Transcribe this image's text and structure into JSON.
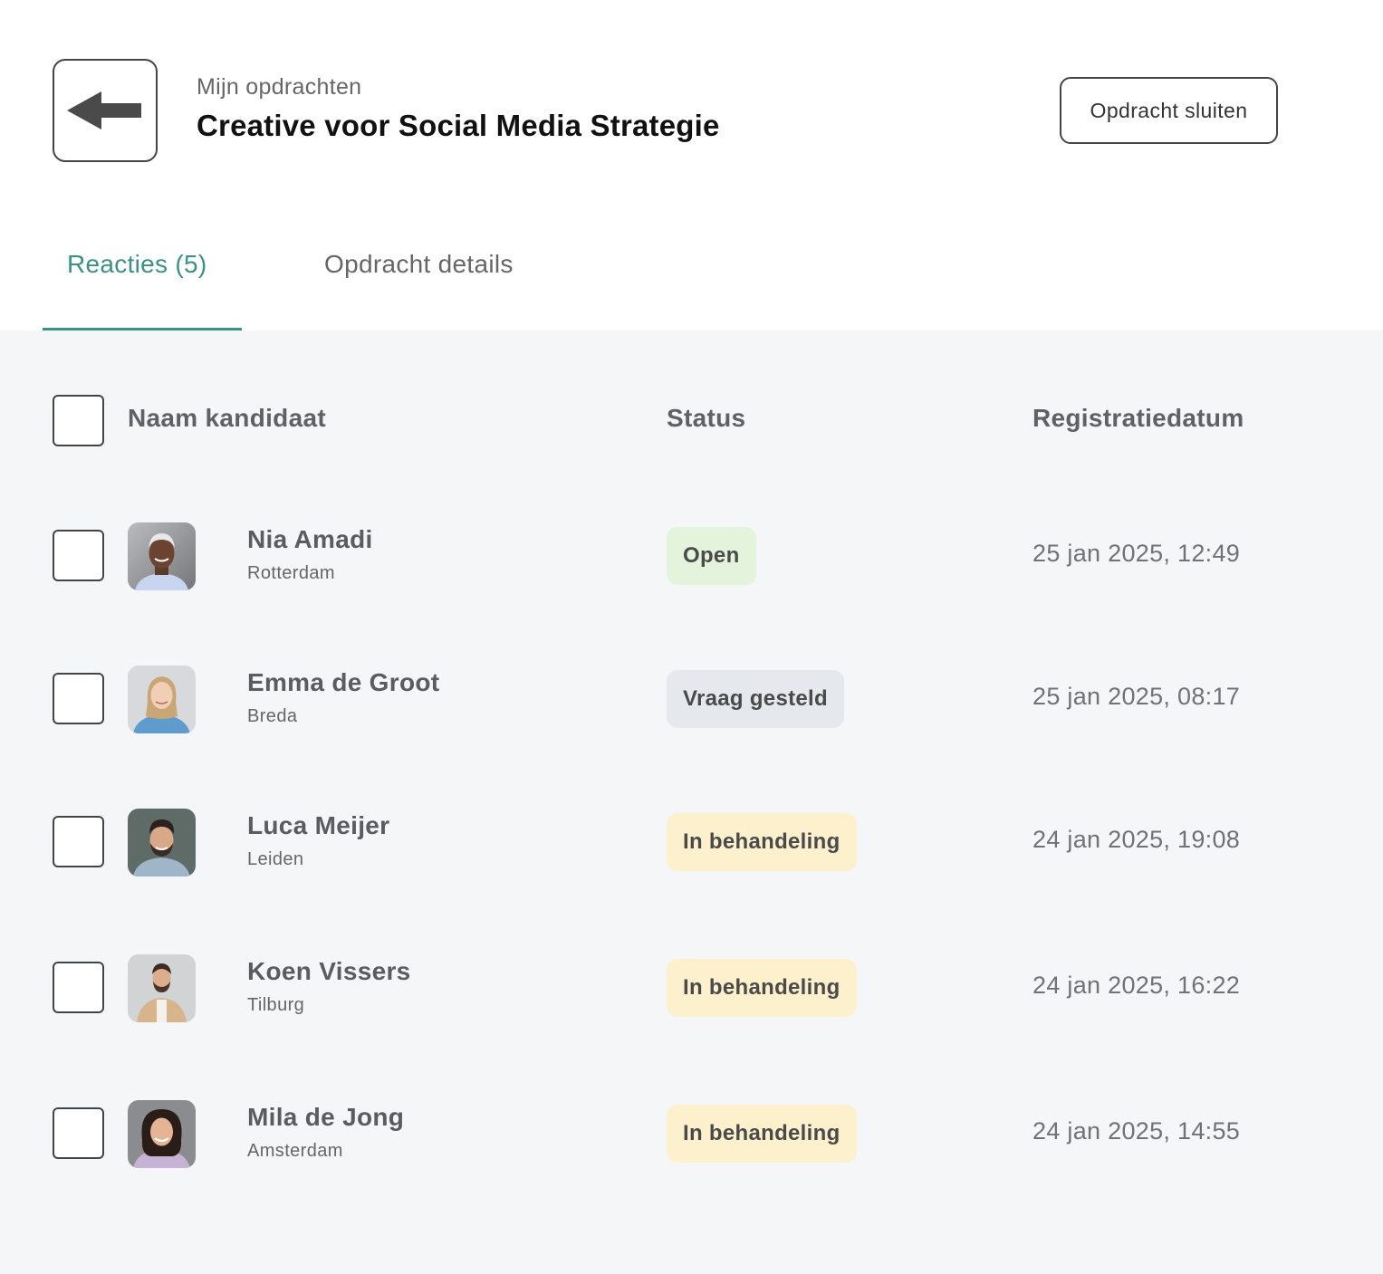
{
  "header": {
    "breadcrumb": "Mijn opdrachten",
    "title": "Creative voor Social Media Strategie",
    "close_label": "Opdracht sluiten",
    "back_icon": "arrow-left-icon"
  },
  "tabs": [
    {
      "label": "Reacties (5)",
      "active": true
    },
    {
      "label": "Opdracht details",
      "active": false
    }
  ],
  "table": {
    "columns": [
      "Naam kandidaat",
      "Status",
      "Registratiedatum"
    ],
    "rows": [
      {
        "name": "Nia Amadi",
        "city": "Rotterdam",
        "status": "Open",
        "status_color": "#e4f3dc",
        "date": "25 jan 2025, 12:49"
      },
      {
        "name": "Emma de Groot",
        "city": "Breda",
        "status": "Vraag gesteld",
        "status_color": "#e5e9ed",
        "date": "25 jan 2025, 08:17"
      },
      {
        "name": "Luca Meijer",
        "city": "Leiden",
        "status": "In behandeling",
        "status_color": "#fdf1cd",
        "date": "24 jan 2025, 19:08"
      },
      {
        "name": "Koen Vissers",
        "city": "Tilburg",
        "status": "In behandeling",
        "status_color": "#fdf1cd",
        "date": "24 jan 2025, 16:22"
      },
      {
        "name": "Mila de Jong",
        "city": "Amsterdam",
        "status": "In behandeling",
        "status_color": "#fdf1cd",
        "date": "24 jan 2025, 14:55"
      }
    ]
  },
  "colors": {
    "accent": "#3a9187",
    "table_background": "#f5f6f8"
  }
}
